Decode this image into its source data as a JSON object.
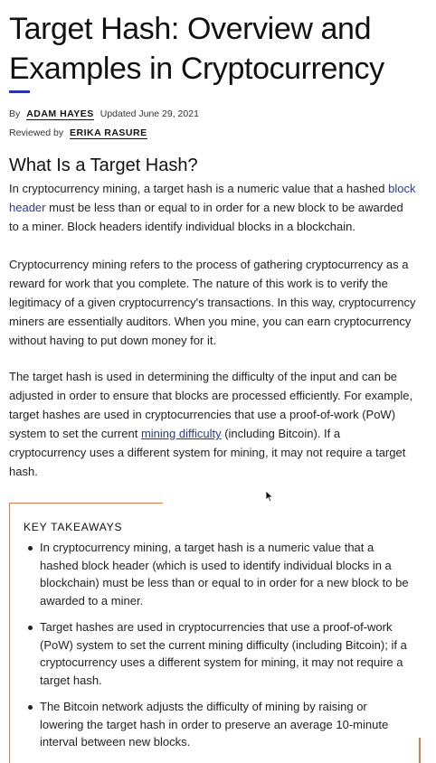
{
  "article": {
    "title": "Target Hash: Overview and Examples in Cryptocurrency",
    "byline": {
      "by_label": "By",
      "author": "ADAM HAYES",
      "updated": "Updated June 29, 2021"
    },
    "reviewed": {
      "label": "Reviewed by",
      "reviewer": "ERIKA RASURE"
    },
    "section_heading": "What Is a Target Hash?",
    "p1": {
      "before": "In cryptocurrency mining, a target hash is a numeric value that a hashed ",
      "link": "block header",
      "after": " must be less than or equal to in order for a new block to be awarded to a miner. Block headers identify individual blocks in a blockchain."
    },
    "p2": "Cryptocurrency mining refers to the process of gathering cryptocurrency as a reward for work that you complete. The nature of this work is to verify the legitimacy of a given cryptocurrency's transactions. In this way, cryptocurrency miners are essentially auditors. When you mine, you can earn cryptocurrency without having to put down money for it.",
    "p3": {
      "before": "The target hash is used in determining the difficulty of the input and can be adjusted in order to ensure that blocks are processed efficiently. For example, target hashes are used in cryptocurrencies that use a proof-of-work (PoW) system to set the current ",
      "link": "mining difficulty",
      "after": " (including Bitcoin). If a cryptocurrency uses a different system for mining, it may not require a target hash."
    },
    "key_takeaways": {
      "heading": "KEY TAKEAWAYS",
      "items": [
        "In cryptocurrency mining, a target hash is a numeric value that a hashed block header (which is used to identify individual blocks in a blockchain) must be less than or equal to in order for a new block to be awarded to a miner.",
        "Target hashes are used in cryptocurrencies that use a proof-of-work (PoW) system to set the current mining difficulty (including Bitcoin); if a cryptocurrency uses a different system for mining, it may not require a target hash.",
        "The Bitcoin network adjusts the difficulty of mining by raising or lowering the target hash in order to preserve an average 10-minute interval between new blocks."
      ]
    }
  },
  "colors": {
    "accent_bar": "#2a35a8",
    "link": "#2a3a9a",
    "takeaways_border": "#e07a4a"
  },
  "icons": {
    "cursor": "mouse-pointer-icon"
  }
}
